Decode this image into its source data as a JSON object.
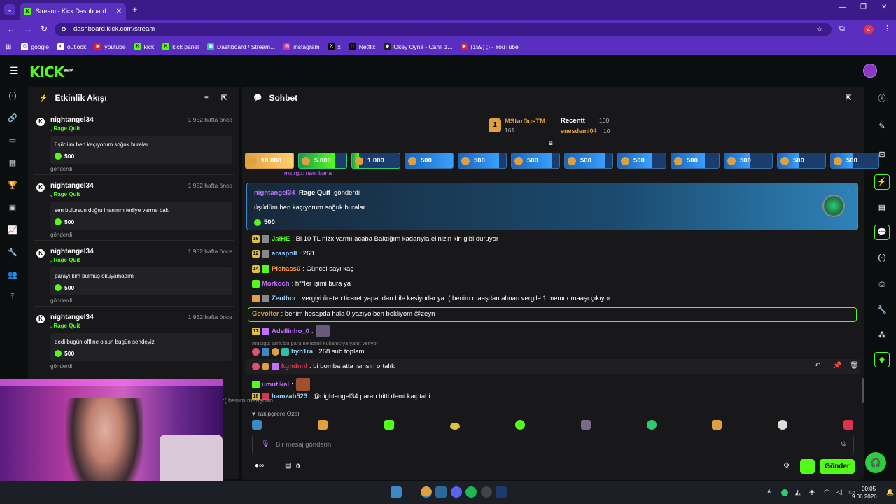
{
  "browser": {
    "tab_title": "Stream - Kick Dashboard",
    "url": "dashboard.kick.com/stream",
    "profile": "Z",
    "bookmarks": [
      "google",
      "outlook",
      "youtube",
      "kick",
      "kick panel",
      "Dashboard / Stream...",
      "instagram",
      "x",
      "Netflix",
      "Okey Oyna - Canlı 1...",
      "(159) ;) - YouTube"
    ]
  },
  "app": {
    "logo": "KICK",
    "logo_beta": "BETA"
  },
  "activity": {
    "title": "Etkinlik Akışı",
    "items": [
      {
        "name": "nightangel34",
        "kind": ", Rage Quit",
        "time": "1.952 hafta önce",
        "message": "üşüdüm ben kaçıyorum soğuk buralar",
        "amount": "500",
        "sent": "gönderdi"
      },
      {
        "name": "nightangel34",
        "kind": ", Rage Quit",
        "time": "1.952 hafta önce",
        "message": "sen bulursun doğru inanırım tediye verme bak",
        "amount": "500",
        "sent": "gönderdi"
      },
      {
        "name": "nightangel34",
        "kind": ", Rage Quit",
        "time": "1.952 hafta önce",
        "message": "parayı kim bulmuş okuyamadım",
        "amount": "500",
        "sent": "gönderdi"
      },
      {
        "name": "nightangel34",
        "kind": ", Rage Quit",
        "time": "1.952 hafta önce",
        "message": "dedi bugün offline olsun bugün sendeyiz",
        "amount": "500",
        "sent": "gönderdi"
      }
    ]
  },
  "chat": {
    "title": "Sohbet",
    "leaderboard": {
      "top_name": "MStarDusTM",
      "top_value": "161",
      "top_rank": "1",
      "recent_label": "Recentt",
      "recent_value": "100",
      "second_name": "enesdemi04",
      "second_value": "10"
    },
    "gifts": [
      {
        "label": "10.000",
        "fill": 1.0,
        "color": "#e0a040"
      },
      {
        "label": "5.000",
        "fill": 0.75,
        "color": "#2ecc71"
      },
      {
        "label": "1.000",
        "fill": 0.15,
        "color": "#2ecc71"
      },
      {
        "label": "500",
        "fill": 1.0,
        "color": "#1e88e5"
      },
      {
        "label": "500",
        "fill": 0.85,
        "color": "#1e88e5"
      },
      {
        "label": "500",
        "fill": 0.85,
        "color": "#1e88e5"
      },
      {
        "label": "500",
        "fill": 0.85,
        "color": "#1e88e5"
      },
      {
        "label": "500",
        "fill": 0.7,
        "color": "#1e88e5"
      },
      {
        "label": "500",
        "fill": 0.7,
        "color": "#1e88e5"
      },
      {
        "label": "500",
        "fill": 0.55,
        "color": "#1e88e5"
      },
      {
        "label": "500",
        "fill": 0.45,
        "color": "#1e88e5"
      },
      {
        "label": "500",
        "fill": 0.45,
        "color": "#1e88e5"
      }
    ],
    "partial_top": "mstrgp: nani bana",
    "highlight": {
      "user": "nightangel34",
      "kind": "Rage Quit",
      "verb": "gönderdi",
      "message": "üşüdüm ben kaçıyorum soğuk buralar",
      "amount": "500"
    },
    "messages": [
      {
        "badge": "16",
        "user": "JaiHE",
        "color": "#53fc18",
        "text": ": Bi 10 TL nizx varmı acaba Baktığım kadarıyla elinizin kiri gibi duruyor"
      },
      {
        "badge": "12",
        "user": "araspoll",
        "color": "#9ad0ff",
        "text": ": 268"
      },
      {
        "badge": "14",
        "user": "Pichass0",
        "color": "#ff9a3a",
        "text": ": Güncel sayı kaç"
      },
      {
        "badge": "",
        "user": "Morkoch",
        "color": "#c070ff",
        "text": ": h**ler işimi bura ya"
      },
      {
        "badge": "",
        "user": "Zeuthor",
        "color": "#9ad0ff",
        "text": ": vergiyi üreten ticaret yapandan bile kesiyorlar ya :( benim maaşdan alınan vergile 1 memur maaşı çıkıyor"
      },
      {
        "badge": "",
        "user": "Gevolter",
        "color": "#e0a040",
        "text": ": benim hesapda hala 0 yazıyo ben bekliyom @zeyn"
      },
      {
        "badge": "17",
        "user": "Adellinho_0",
        "color": "#c070ff",
        "text": ":"
      },
      {
        "badge": "",
        "user": "byh1ra",
        "color": "#9ad0ff",
        "text": ": 268 sub toplam"
      },
      {
        "badge": "",
        "user": "kgndnnl",
        "color": "#e03050",
        "text": ": bi bomba atta ısınsın ortalık"
      },
      {
        "badge": "",
        "user": "umutikal",
        "color": "#c070ff",
        "text": ":"
      },
      {
        "badge": "18",
        "user": "hamzab523",
        "color": "#9ad0ff",
        "text": ": @nightangel34 paran bitti demi kaç tabi"
      }
    ],
    "reply_hint": "mustgp: amk bu para ne isimli kullanıcıya yanıt veriyor",
    "followers_only": "Takipçilere Özel",
    "input_placeholder": "Bir mesaj gönderin",
    "bottom_count": "0",
    "send_label": "Gönder"
  },
  "taskbar": {
    "time": "00:05",
    "date": "9.06.2026"
  },
  "webcam": {
    "overlay_text": ":( benim maaşdan"
  }
}
